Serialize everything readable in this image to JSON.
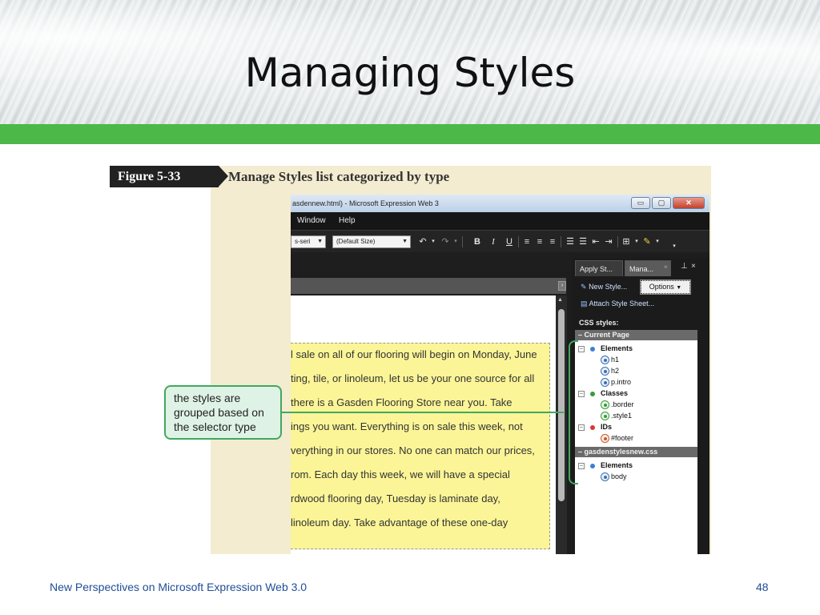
{
  "slide": {
    "title": "Managing Styles",
    "footer": "New Perspectives on Microsoft Expression Web 3.0",
    "page_number": "48"
  },
  "figure": {
    "tag": "Figure 5-33",
    "caption": "Manage Styles list categorized by type"
  },
  "window": {
    "title": "asdennew.html) - Microsoft Expression Web 3",
    "buttons": [
      "▭",
      "▢",
      "✕"
    ]
  },
  "menu": {
    "items": [
      "Window",
      "Help"
    ]
  },
  "toolbar": {
    "font_family": "s-seri",
    "font_size": "(Default Size)",
    "buttons": [
      "B",
      "I",
      "U"
    ]
  },
  "editor": {
    "lines": [
      "l sale on all of our flooring will begin on Monday, June",
      "ting, tile, or linoleum, let us be your one source for all",
      " there is a Gasden Flooring Store near you. Take",
      "ings you want. Everything is on sale this week, not",
      "verything in our stores. No one can match our prices,",
      "rom. Each day this week, we will have a special",
      "rdwood flooring day, Tuesday is laminate day,",
      " linoleum day. Take advantage of these one-day"
    ]
  },
  "panel": {
    "tabs": [
      "Apply St...",
      "Mana..."
    ],
    "new_style": "New Style...",
    "options": "Options",
    "attach": "Attach Style Sheet...",
    "css_styles_label": "CSS styles:",
    "current_page": "Current Page",
    "groups": [
      {
        "label": "Elements",
        "items": [
          "h1",
          "h2",
          "p.intro"
        ]
      },
      {
        "label": "Classes",
        "items": [
          ".border",
          ".style1"
        ]
      },
      {
        "label": "IDs",
        "items": [
          "#footer"
        ]
      }
    ],
    "stylesheet": "gasdenstylesnew.css",
    "sheet_groups": [
      {
        "label": "Elements",
        "items": [
          "body"
        ]
      }
    ]
  },
  "callout": {
    "text": "the styles are grouped based on the selector type"
  },
  "colors": {
    "accent_green": "#4cb848",
    "callout_border": "#41a85f",
    "highlight_yellow": "#fbf597",
    "footer_blue": "#1f4d9a"
  }
}
